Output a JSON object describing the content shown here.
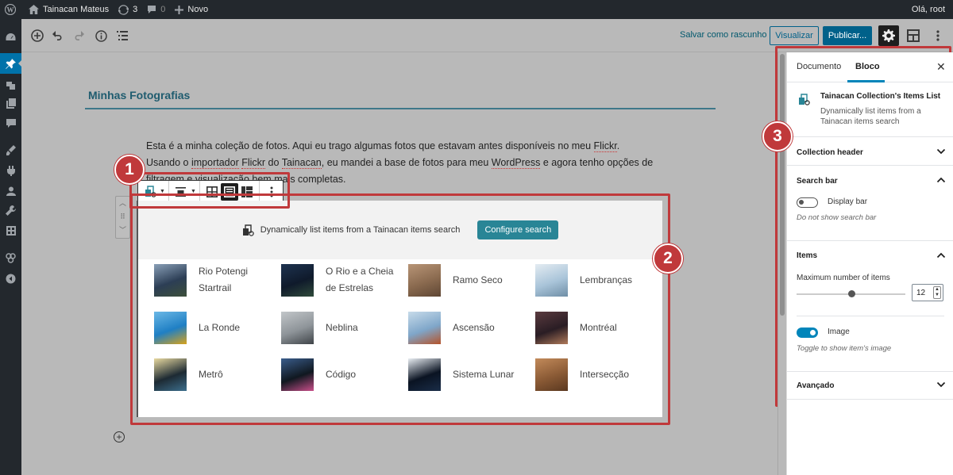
{
  "admin_bar": {
    "site_name": "Tainacan Mateus",
    "updates_count": "3",
    "comments_count": "0",
    "new_label": "Novo",
    "greeting": "Olá, root"
  },
  "toolbar": {
    "draft_label": "Salvar como rascunho",
    "preview_label": "Visualizar",
    "publish_label": "Publicar..."
  },
  "post": {
    "title": "Minhas Fotografias",
    "paragraph": [
      {
        "text": "Esta é a minha coleção de fotos. Aqui eu trago algumas fotos que estavam antes disponíveis no meu "
      },
      {
        "text": "Flickr",
        "spell": true
      },
      {
        "text": ". Usando o "
      },
      {
        "text": "importador",
        "spell": true
      },
      {
        "text": " "
      },
      {
        "text": "Flickr",
        "spell": true
      },
      {
        "text": " do "
      },
      {
        "text": "Tainacan",
        "spell": true
      },
      {
        "text": ", eu mandei a base de fotos para meu "
      },
      {
        "text": "WordPress",
        "spell": true
      },
      {
        "text": " e agora tenho opções de filtragem e "
      },
      {
        "text": "visualização bem mais completas."
      }
    ]
  },
  "items_block": {
    "header_text": "Dynamically list items from a Tainacan items search",
    "configure_label": "Configure search",
    "items": [
      {
        "label": "Rio Potengi Startrail",
        "thumb": [
          "#2c3e55",
          "#8aa0b8",
          "#3d4f3a"
        ]
      },
      {
        "label": "O Rio e a Cheia de Estrelas",
        "thumb": [
          "#0f1a2b",
          "#1e3350",
          "#2f4a3a"
        ]
      },
      {
        "label": "Ramo Seco",
        "thumb": [
          "#8a6a4f",
          "#b89577",
          "#5e4634"
        ]
      },
      {
        "label": "Lembranças",
        "thumb": [
          "#a9c4d9",
          "#e4ecf2",
          "#6f8ea6"
        ]
      },
      {
        "label": "La Ronde",
        "thumb": [
          "#1f7fc4",
          "#6bb8e6",
          "#d8a21a"
        ]
      },
      {
        "label": "Neblina",
        "thumb": [
          "#8e9499",
          "#c2c6c9",
          "#3f4448"
        ]
      },
      {
        "label": "Ascensão",
        "thumb": [
          "#7fa6c9",
          "#c7dbea",
          "#b5532a"
        ]
      },
      {
        "label": "Montréal",
        "thumb": [
          "#2a1d24",
          "#5a3b3f",
          "#b07a5a"
        ]
      },
      {
        "label": "Metrô",
        "thumb": [
          "#1d2a33",
          "#e8d9a0",
          "#3c6e8c"
        ]
      },
      {
        "label": "Código",
        "thumb": [
          "#101820",
          "#3a5d8c",
          "#c94f8a"
        ]
      },
      {
        "label": "Sistema Lunar",
        "thumb": [
          "#0a1322",
          "#e9eef3",
          "#1a2d48"
        ]
      },
      {
        "label": "Intersecção",
        "thumb": [
          "#8a5a35",
          "#c28a5a",
          "#5a3820"
        ]
      }
    ]
  },
  "settings_panel": {
    "tab_document": "Documento",
    "tab_block": "Bloco",
    "block_title": "Tainacan Collection's Items List",
    "block_description": "Dynamically list items from a Tainacan items search",
    "collection_header": "Collection header",
    "search_bar": "Search bar",
    "display_bar": "Display bar",
    "display_bar_help": "Do not show search bar",
    "items": "Items",
    "max_items_label": "Maximum number of items",
    "max_items_value": "12",
    "image_label": "Image",
    "image_help": "Toggle to show item's image",
    "advanced": "Avançado"
  },
  "annotations": {
    "badge_1": "1",
    "badge_2": "2",
    "badge_3": "3",
    "color": "#c0393b"
  }
}
